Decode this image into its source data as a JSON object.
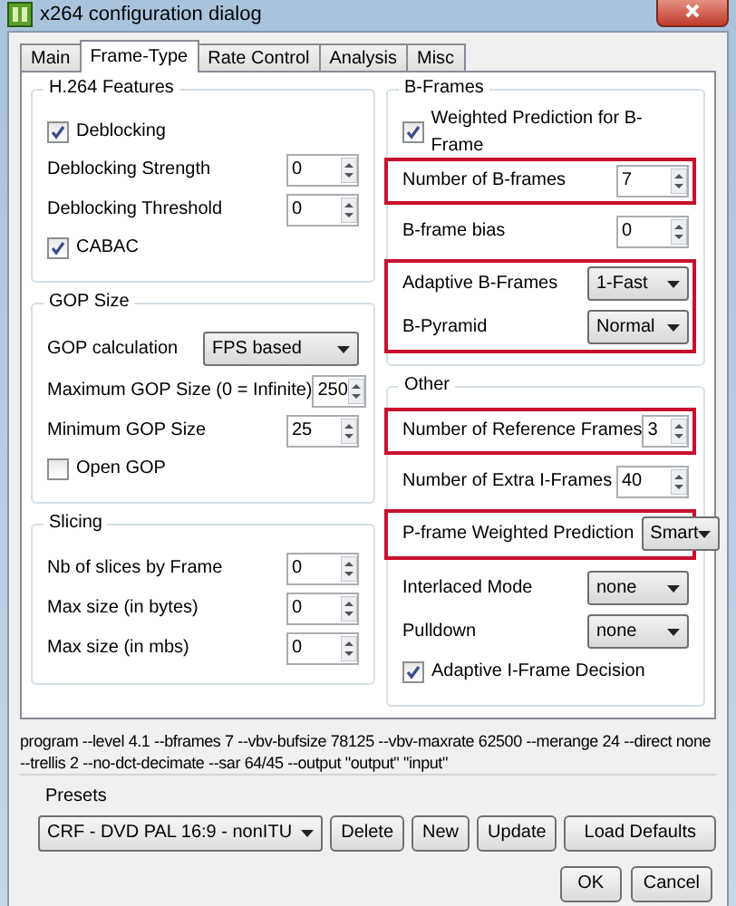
{
  "window": {
    "title": "x264 configuration dialog"
  },
  "tabs": [
    {
      "label": "Main",
      "selected": false
    },
    {
      "label": "Frame-Type",
      "selected": true
    },
    {
      "label": "Rate Control",
      "selected": false
    },
    {
      "label": "Analysis",
      "selected": false
    },
    {
      "label": "Misc",
      "selected": false
    }
  ],
  "left_groups": [
    {
      "title": "H.264 Features",
      "blocks": [
        {
          "highlighted": false,
          "rows": [
            {
              "kind": "checkbox",
              "label": "Deblocking",
              "checked": true
            },
            {
              "kind": "spin",
              "label": "Deblocking Strength",
              "value": "0"
            },
            {
              "kind": "spin",
              "label": "Deblocking Threshold",
              "value": "0"
            },
            {
              "kind": "checkbox",
              "label": "CABAC",
              "checked": true
            }
          ]
        }
      ]
    },
    {
      "title": "GOP Size",
      "blocks": [
        {
          "highlighted": false,
          "rows": [
            {
              "kind": "combo",
              "label": "GOP calculation",
              "value": "FPS based"
            },
            {
              "kind": "spin",
              "label": "Maximum GOP Size (0 = Infinite)",
              "value": "250"
            },
            {
              "kind": "spin",
              "label": "Minimum GOP Size",
              "value": "25"
            },
            {
              "kind": "checkbox",
              "label": "Open GOP",
              "checked": false
            }
          ]
        }
      ]
    },
    {
      "title": "Slicing",
      "blocks": [
        {
          "highlighted": false,
          "rows": [
            {
              "kind": "spin",
              "label": "Nb of slices by Frame",
              "value": "0"
            },
            {
              "kind": "spin",
              "label": "Max size (in bytes)",
              "value": "0"
            },
            {
              "kind": "spin",
              "label": "Max size (in mbs)",
              "value": "0"
            }
          ]
        }
      ]
    }
  ],
  "right_groups": [
    {
      "title": "B-Frames",
      "blocks": [
        {
          "highlighted": false,
          "rows": [
            {
              "kind": "checkbox",
              "label": "Weighted Prediction for B-Frame",
              "checked": true
            }
          ]
        },
        {
          "highlighted": true,
          "rows": [
            {
              "kind": "spin",
              "label": "Number of B-frames",
              "value": "7"
            }
          ]
        },
        {
          "highlighted": false,
          "rows": [
            {
              "kind": "spin",
              "label": "B-frame bias",
              "value": "0"
            }
          ]
        },
        {
          "highlighted": true,
          "rows": [
            {
              "kind": "combo",
              "label": "Adaptive B-Frames",
              "value": "1-Fast"
            },
            {
              "kind": "combo",
              "label": "B-Pyramid",
              "value": "Normal"
            }
          ]
        }
      ]
    },
    {
      "title": "Other",
      "blocks": [
        {
          "highlighted": true,
          "rows": [
            {
              "kind": "spin",
              "label": "Number of Reference Frames",
              "value": "3"
            }
          ]
        },
        {
          "highlighted": false,
          "rows": [
            {
              "kind": "spin",
              "label": "Number of Extra I-Frames",
              "value": "40"
            }
          ]
        },
        {
          "highlighted": true,
          "rows": [
            {
              "kind": "combo",
              "label": "P-frame Weighted Prediction",
              "value": "Smart"
            }
          ]
        },
        {
          "highlighted": false,
          "rows": [
            {
              "kind": "combo",
              "label": "Interlaced Mode",
              "value": "none"
            },
            {
              "kind": "combo",
              "label": "Pulldown",
              "value": "none"
            },
            {
              "kind": "checkbox",
              "label": "Adaptive I-Frame Decision",
              "checked": true
            }
          ]
        }
      ]
    }
  ],
  "command_line": "program --level 4.1 --bframes 7 --vbv-bufsize 78125 --vbv-maxrate 62500 --merange 24 --direct none --trellis 2 --no-dct-decimate --sar 64/45 --output \"output\" \"input\"",
  "presets": {
    "title": "Presets",
    "value": "CRF - DVD PAL 16:9 - nonITU",
    "buttons": [
      "Delete",
      "New",
      "Update",
      "Load Defaults"
    ]
  },
  "dialog_buttons": [
    "OK",
    "Cancel"
  ]
}
